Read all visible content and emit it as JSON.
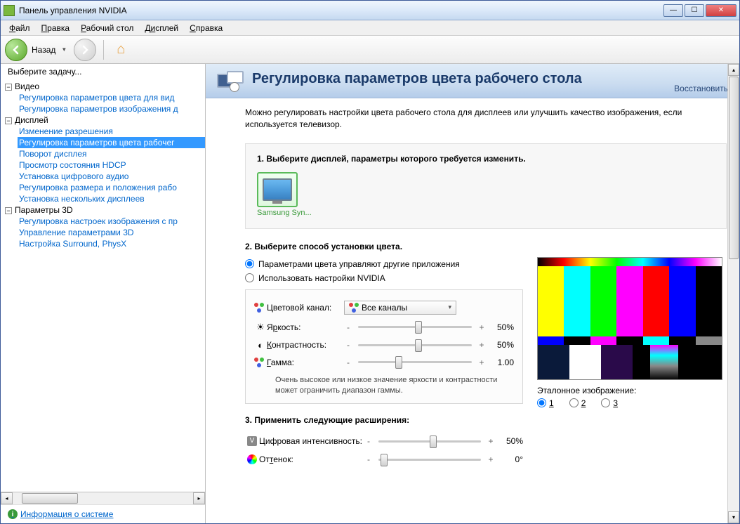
{
  "window": {
    "title": "Панель управления NVIDIA"
  },
  "menu": {
    "file": "Файл",
    "edit": "Правка",
    "desktop": "Рабочий стол",
    "display": "Дисплей",
    "help": "Справка"
  },
  "toolbar": {
    "back": "Назад"
  },
  "sidebar": {
    "header": "Выберите задачу...",
    "cat_video": "Видео",
    "video_items": [
      "Регулировка параметров цвета для вид",
      "Регулировка параметров изображения д"
    ],
    "cat_display": "Дисплей",
    "display_items": [
      "Изменение разрешения",
      "Регулировка параметров цвета рабочег",
      "Поворот дисплея",
      "Просмотр состояния HDCP",
      "Установка цифрового аудио",
      "Регулировка размера и положения рабо",
      "Установка нескольких дисплеев"
    ],
    "display_selected": 1,
    "cat_3d": "Параметры 3D",
    "d3_items": [
      "Регулировка настроек изображения с пр",
      "Управление параметрами 3D",
      "Настройка Surround, PhysX"
    ],
    "sysinfo": "Информация о системе"
  },
  "main": {
    "title": "Регулировка параметров цвета рабочего стола",
    "restore": "Восстановить",
    "intro": "Можно регулировать настройки цвета рабочего стола для дисплеев или улучшить качество изображения, если используется телевизор.",
    "s1_title": "1. Выберите дисплей, параметры которого требуется изменить.",
    "display_name": "Samsung Syn...",
    "s2_title": "2. Выберите способ установки цвета.",
    "radio_other": "Параметрами цвета управляют другие приложения",
    "radio_nvidia": "Использовать настройки NVIDIA",
    "channel_label": "Цветовой канал:",
    "channel_value": "Все каналы",
    "brightness_label": "Яркость:",
    "brightness_value": "50%",
    "contrast_label": "Контрастность:",
    "contrast_value": "50%",
    "gamma_label": "Гамма:",
    "gamma_value": "1.00",
    "hint": "Очень высокое или низкое значение яркости и контрастности может ограничить диапазон гаммы.",
    "s3_title": "3. Применить следующие расширения:",
    "dvi_label": "Цифровая интенсивность:",
    "dvi_value": "50%",
    "hue_label": "Оттенок:",
    "hue_value": "0°",
    "ref_label": "Эталонное изображение:",
    "ref_1": "1",
    "ref_2": "2",
    "ref_3": "3"
  }
}
